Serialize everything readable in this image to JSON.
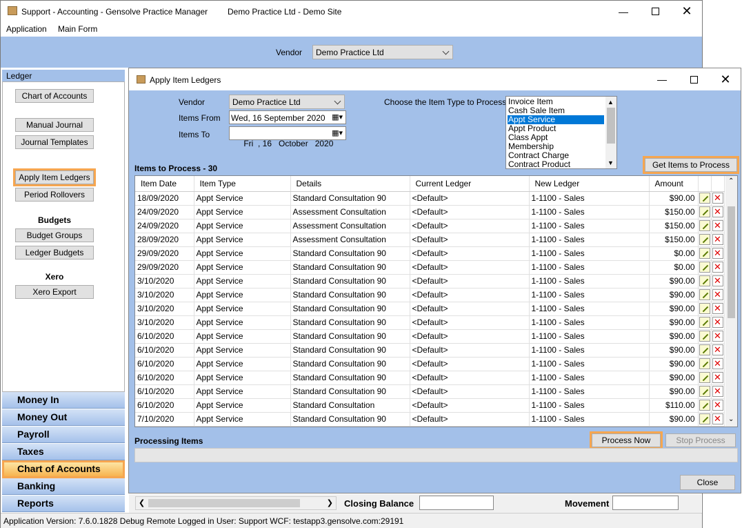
{
  "app": {
    "title": "Support - Accounting - Gensolve Practice Manager",
    "site": "Demo Practice Ltd - Demo Site"
  },
  "menu": [
    "Application",
    "Main Form"
  ],
  "top": {
    "vendor_label": "Vendor",
    "vendor_value": "Demo Practice Ltd"
  },
  "ledger_header": "Ledger",
  "left_buttons": {
    "chart": "Chart of Accounts",
    "manual": "Manual Journal",
    "templates": "Journal Templates",
    "apply": "Apply Item Ledgers",
    "rollovers": "Period Rollovers",
    "budgets_hdr": "Budgets",
    "budget_groups": "Budget Groups",
    "ledger_budgets": "Ledger Budgets",
    "xero_hdr": "Xero",
    "xero_export": "Xero Export"
  },
  "nav": [
    "Money In",
    "Money Out",
    "Payroll",
    "Taxes",
    "Chart of Accounts",
    "Banking",
    "Reports"
  ],
  "nav_selected": "Chart of Accounts",
  "status": "Application Version: 7.6.0.1828 Debug Remote   Logged in User: Support WCF: testapp3.gensolve.com:29191",
  "bottom": {
    "closing_balance": "Closing Balance",
    "movement": "Movement"
  },
  "child": {
    "title": "Apply Item Ledgers",
    "vendor_label": "Vendor",
    "vendor_value": "Demo Practice Ltd",
    "from_label": "Items From",
    "from_value": "Wed, 16 September 2020",
    "to_label": "Items To",
    "to_value": "Fri  , 16   October   2020",
    "type_label": "Choose the Item Type to Process",
    "types": [
      "Invoice Item",
      "Cash Sale Item",
      "Appt Service",
      "Appt Product",
      "Class Appt",
      "Membership",
      "Contract Charge",
      "Contract Product"
    ],
    "type_selected": "Appt Service",
    "get_btn": "Get Items to Process",
    "items_header": "Items to Process - 30",
    "columns": [
      "Item Date",
      "Item Type",
      "Details",
      "Current Ledger",
      "New Ledger",
      "Amount"
    ],
    "rows": [
      [
        "18/09/2020",
        "Appt Service",
        "Standard Consultation 90",
        "<Default>",
        "1-1100 - Sales",
        "$90.00"
      ],
      [
        "24/09/2020",
        "Appt Service",
        "Assessment Consultation",
        "<Default>",
        "1-1100 - Sales",
        "$150.00"
      ],
      [
        "24/09/2020",
        "Appt Service",
        "Assessment Consultation",
        "<Default>",
        "1-1100 - Sales",
        "$150.00"
      ],
      [
        "28/09/2020",
        "Appt Service",
        "Assessment Consultation",
        "<Default>",
        "1-1100 - Sales",
        "$150.00"
      ],
      [
        "29/09/2020",
        "Appt Service",
        "Standard Consultation 90",
        "<Default>",
        "1-1100 - Sales",
        "$0.00"
      ],
      [
        "29/09/2020",
        "Appt Service",
        "Standard Consultation 90",
        "<Default>",
        "1-1100 - Sales",
        "$0.00"
      ],
      [
        "3/10/2020",
        "Appt Service",
        "Standard Consultation 90",
        "<Default>",
        "1-1100 - Sales",
        "$90.00"
      ],
      [
        "3/10/2020",
        "Appt Service",
        "Standard Consultation 90",
        "<Default>",
        "1-1100 - Sales",
        "$90.00"
      ],
      [
        "3/10/2020",
        "Appt Service",
        "Standard Consultation 90",
        "<Default>",
        "1-1100 - Sales",
        "$90.00"
      ],
      [
        "3/10/2020",
        "Appt Service",
        "Standard Consultation 90",
        "<Default>",
        "1-1100 - Sales",
        "$90.00"
      ],
      [
        "6/10/2020",
        "Appt Service",
        "Standard Consultation 90",
        "<Default>",
        "1-1100 - Sales",
        "$90.00"
      ],
      [
        "6/10/2020",
        "Appt Service",
        "Standard Consultation 90",
        "<Default>",
        "1-1100 - Sales",
        "$90.00"
      ],
      [
        "6/10/2020",
        "Appt Service",
        "Standard Consultation 90",
        "<Default>",
        "1-1100 - Sales",
        "$90.00"
      ],
      [
        "6/10/2020",
        "Appt Service",
        "Standard Consultation 90",
        "<Default>",
        "1-1100 - Sales",
        "$90.00"
      ],
      [
        "6/10/2020",
        "Appt Service",
        "Standard Consultation 90",
        "<Default>",
        "1-1100 - Sales",
        "$90.00"
      ],
      [
        "6/10/2020",
        "Appt Service",
        "Standard Consultation",
        "<Default>",
        "1-1100 - Sales",
        "$110.00"
      ],
      [
        "7/10/2020",
        "Appt Service",
        "Standard Consultation 90",
        "<Default>",
        "1-1100 - Sales",
        "$90.00"
      ]
    ],
    "processing_label": "Processing Items",
    "process_btn": "Process Now",
    "stop_btn": "Stop Process",
    "close_btn": "Close"
  },
  "colors": {
    "accent_blue": "#a3c0e9",
    "highlight": "#f6a650",
    "selection": "#0078d7"
  }
}
